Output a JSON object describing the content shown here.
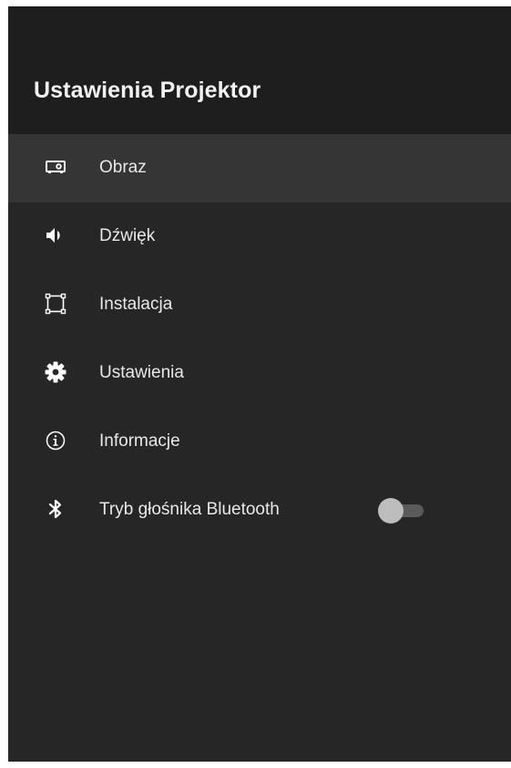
{
  "header": {
    "title": "Ustawienia Projektor"
  },
  "menu": {
    "items": [
      {
        "label": "Obraz",
        "icon": "projector-icon",
        "selected": true
      },
      {
        "label": "Dźwięk",
        "icon": "speaker-icon"
      },
      {
        "label": "Instalacja",
        "icon": "keystone-frame-icon"
      },
      {
        "label": "Ustawienia",
        "icon": "gear-icon"
      },
      {
        "label": "Informacje",
        "icon": "info-icon"
      },
      {
        "label": "Tryb głośnika Bluetooth",
        "icon": "bluetooth-icon",
        "toggle": {
          "on": false
        }
      }
    ]
  },
  "colors": {
    "header_bg": "#1e1e1e",
    "panel_bg": "#262626",
    "selected_bg": "#353535",
    "text": "#e8e8e8"
  }
}
